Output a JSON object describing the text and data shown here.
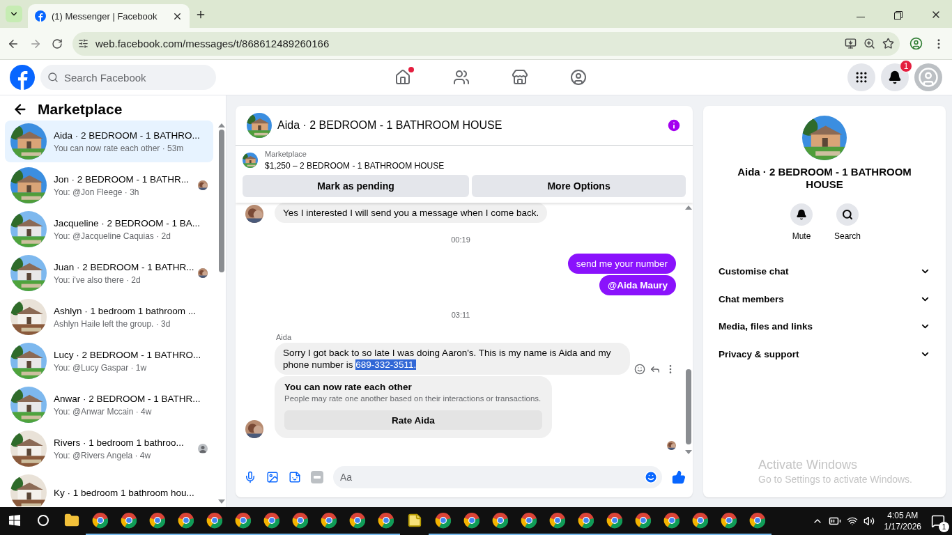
{
  "browser": {
    "tab_title": "(1) Messenger | Facebook",
    "url": "web.facebook.com/messages/t/868612489260166"
  },
  "header": {
    "search_placeholder": "Search Facebook",
    "notification_count": "1"
  },
  "sidebar": {
    "title": "Marketplace",
    "conversations": [
      {
        "kind": "plain",
        "name": "Aida · 2 BEDROOM - 1 BATHRO...",
        "preview": "You can now rate each other · 53m",
        "selected": true
      },
      {
        "kind": "seen_photo",
        "name": "Jon · 2 BEDROOM - 1 BATHR...",
        "preview": "You: @Jon Fleege · 3h",
        "selected": false
      },
      {
        "kind": "plain",
        "name": "Jacqueline · 2 BEDROOM - 1 BA...",
        "preview": "You: @Jacqueline Caquias · 2d",
        "selected": false
      },
      {
        "kind": "seen_photo",
        "name": "Juan · 2 BEDROOM - 1 BATHR...",
        "preview": "You: i've also there · 2d",
        "selected": false
      },
      {
        "kind": "plain",
        "name": "Ashlyn · 1 bedroom 1 bathroom ...",
        "preview": "Ashlyn Haile left the group. · 3d",
        "selected": false
      },
      {
        "kind": "plain",
        "name": "Lucy · 2 BEDROOM - 1 BATHRO...",
        "preview": "You: @Lucy Gaspar · 1w",
        "selected": false
      },
      {
        "kind": "plain",
        "name": "Anwar · 2 BEDROOM - 1 BATHR...",
        "preview": "You: @Anwar Mccain · 4w",
        "selected": false
      },
      {
        "kind": "seen_silhouette",
        "name": "Rivers · 1 bedroom 1 bathroo...",
        "preview": "You: @Rivers Angela · 4w",
        "selected": false
      },
      {
        "kind": "plain",
        "name": "Ky · 1 bedroom 1 bathroom hou...",
        "selected": false
      }
    ]
  },
  "chat": {
    "title": "Aida · 2 BEDROOM - 1 BATHROOM HOUSE",
    "listing": {
      "label": "Marketplace",
      "title": "$1,250 – 2 BEDROOM - 1 BATHROOM HOUSE"
    },
    "actions": [
      "Mark as pending",
      "More Options"
    ],
    "messages": [
      {
        "kind": "incoming",
        "text": "Yes I interested I will send you a message when I come back."
      },
      {
        "kind": "timestamp",
        "text": "00:19"
      },
      {
        "kind": "outgoing",
        "text": "send me your number"
      },
      {
        "kind": "mention",
        "text": "@Aida Maury"
      },
      {
        "kind": "timestamp",
        "text": "03:11"
      },
      {
        "kind": "incoming",
        "sender": "Aida",
        "text": "Sorry I got back to so late I was doing Aaron's.  This is my name is Aida and my phone number is ",
        "highlight": "689-332-3511."
      },
      {
        "kind": "rating",
        "title": "You can now rate each other",
        "text": "People may rate one another based on their interactions or transactions.",
        "button": "Rate Aida"
      }
    ],
    "composer_placeholder": "Aa"
  },
  "details": {
    "title": "Aida · 2 BEDROOM - 1 BATHROOM HOUSE",
    "actions": [
      {
        "kind": "mute",
        "label": "Mute"
      },
      {
        "kind": "search",
        "label": "Search"
      }
    ],
    "sections": [
      {
        "label": "Customise chat",
        "expanded": false
      },
      {
        "label": "Chat members",
        "expanded": false
      },
      {
        "label": "Media, files and links",
        "expanded": false
      },
      {
        "label": "Privacy & support",
        "expanded": false
      }
    ]
  },
  "activation": {
    "title": "Activate Windows",
    "text": "Go to Settings to activate Windows."
  },
  "taskbar": {
    "time": "4:05 AM",
    "date": "1/17/2026",
    "notification_count": "1"
  }
}
